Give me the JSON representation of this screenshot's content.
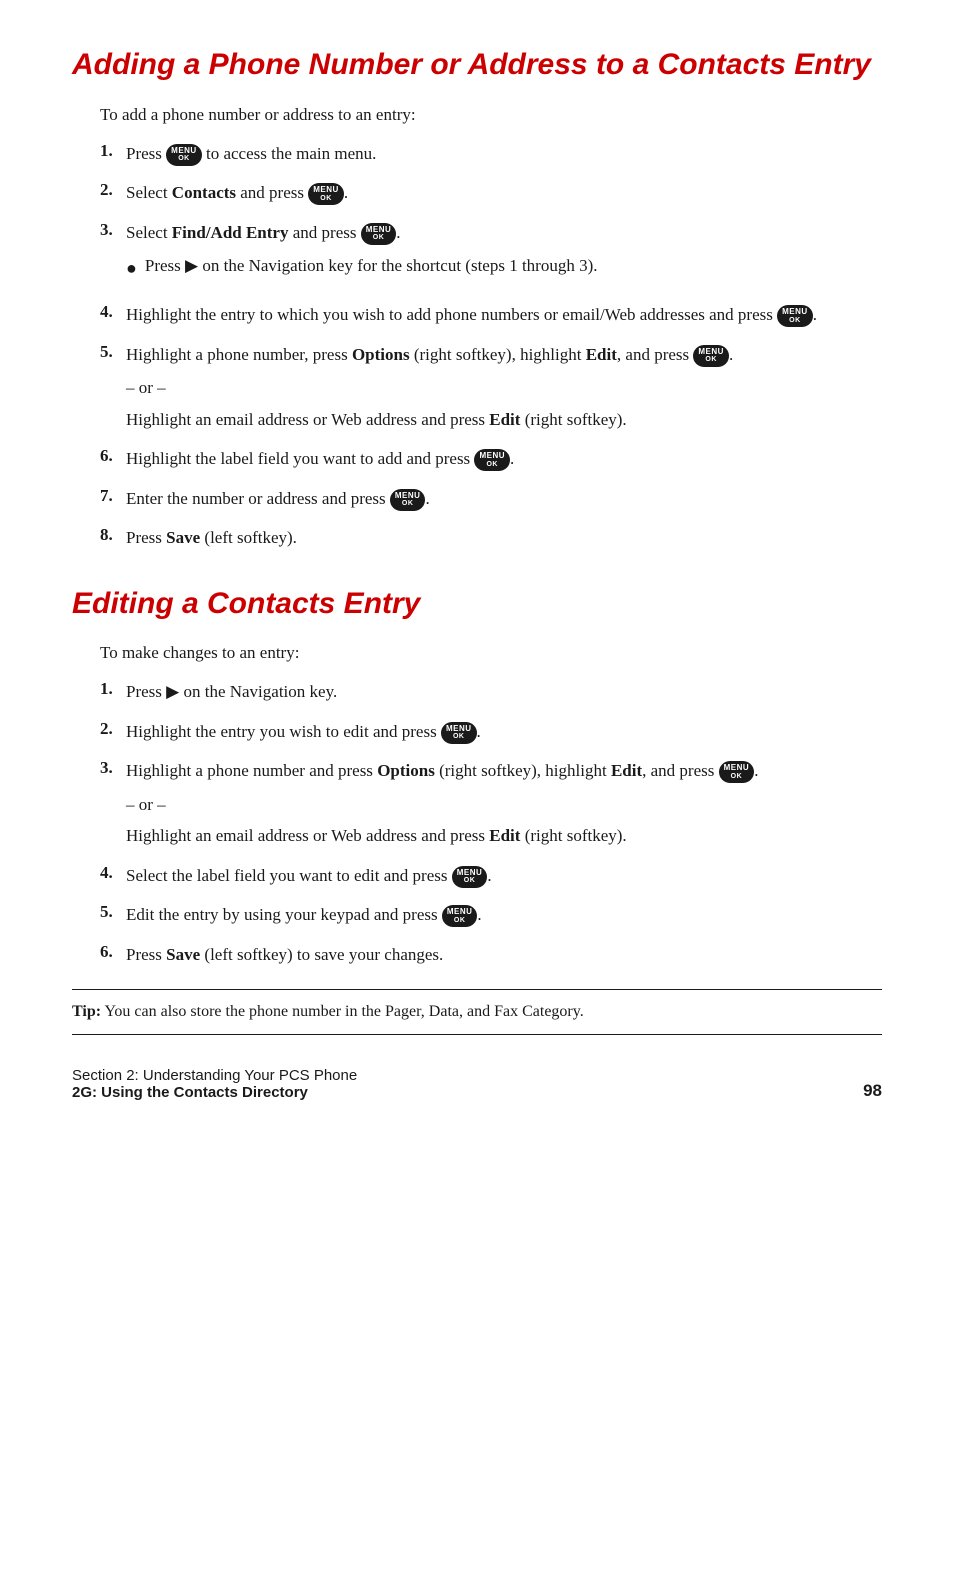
{
  "section1": {
    "title": "Adding a Phone Number or Address to a Contacts Entry",
    "intro": "To add a phone number or address to an entry:",
    "steps": [
      {
        "num": "1.",
        "text_before": "Press ",
        "has_btn": true,
        "btn_label": "MENU\nOK",
        "text_after": " to access the main menu.",
        "sub_items": []
      },
      {
        "num": "2.",
        "text_before": "Select ",
        "bold1": "Contacts",
        "text_mid": " and press ",
        "has_btn": true,
        "btn_label": "MENU\nOK",
        "text_after": ".",
        "sub_items": []
      },
      {
        "num": "3.",
        "text_before": "Select ",
        "bold1": "Find/Add Entry",
        "text_mid": " and press ",
        "has_btn": true,
        "btn_label": "MENU\nOK",
        "text_after": ".",
        "sub_items": [
          {
            "text_before": "Press ▶ on the Navigation key for the shortcut (steps 1 through 3)."
          }
        ]
      },
      {
        "num": "4.",
        "text_before": "Highlight the entry to which you wish to add phone numbers or email/Web addresses and press ",
        "has_btn": true,
        "btn_label": "MENU\nOK",
        "text_after": ".",
        "sub_items": []
      },
      {
        "num": "5.",
        "text_before": "Highlight a phone number, press ",
        "bold1": "Options",
        "text_mid": " (right softkey), highlight ",
        "bold2": "Edit",
        "text_mid2": ", and press ",
        "has_btn": true,
        "btn_label": "MENU\nOK",
        "text_after": ".",
        "has_or": true,
        "or_text": "Highlight an email address or Web address and press ",
        "or_bold": "Edit",
        "or_after": " (right softkey).",
        "sub_items": []
      },
      {
        "num": "6.",
        "text_before": "Highlight the label field you want to add and press ",
        "has_btn": true,
        "btn_label": "MENU\nOK",
        "text_after": ".",
        "sub_items": []
      },
      {
        "num": "7.",
        "text_before": "Enter the number or address and press ",
        "has_btn": true,
        "btn_label": "MENU\nOK",
        "text_after": ".",
        "sub_items": []
      },
      {
        "num": "8.",
        "text_before": "Press ",
        "bold1": "Save",
        "text_after2": " (left softkey).",
        "sub_items": []
      }
    ]
  },
  "section2": {
    "title": "Editing a Contacts Entry",
    "intro": "To make changes to an entry:",
    "steps": [
      {
        "num": "1.",
        "text_before": "Press ▶ on the Navigation key.",
        "sub_items": []
      },
      {
        "num": "2.",
        "text_before": "Highlight the entry you wish to edit and press ",
        "has_btn": true,
        "btn_label": "MENU\nOK",
        "text_after": ".",
        "sub_items": []
      },
      {
        "num": "3.",
        "text_before": "Highlight a phone number and press ",
        "bold1": "Options",
        "text_mid": " (right softkey), highlight ",
        "bold2": "Edit",
        "text_mid2": ", and press ",
        "has_btn": true,
        "btn_label": "MENU\nOK",
        "text_after": ".",
        "has_or": true,
        "or_text": "Highlight an email address or Web address and press ",
        "or_bold": "Edit",
        "or_after": " (right softkey).",
        "sub_items": []
      },
      {
        "num": "4.",
        "text_before": "Select the label field you want to edit and press ",
        "has_btn": true,
        "btn_label": "MENU\nOK",
        "text_after": ".",
        "sub_items": []
      },
      {
        "num": "5.",
        "text_before": "Edit the entry by using your keypad and press ",
        "has_btn": true,
        "btn_label": "MENU\nOK",
        "text_after": ".",
        "sub_items": []
      },
      {
        "num": "6.",
        "text_before": "Press ",
        "bold1": "Save",
        "text_after2": " (left softkey) to save your changes.",
        "sub_items": []
      }
    ]
  },
  "tip": {
    "label": "Tip:",
    "text": " You can also store the phone number in the Pager, Data, and Fax Category."
  },
  "footer": {
    "section_main": "Section 2: Understanding Your PCS Phone",
    "section_sub": "2G: Using the Contacts Directory",
    "page_num": "98"
  }
}
